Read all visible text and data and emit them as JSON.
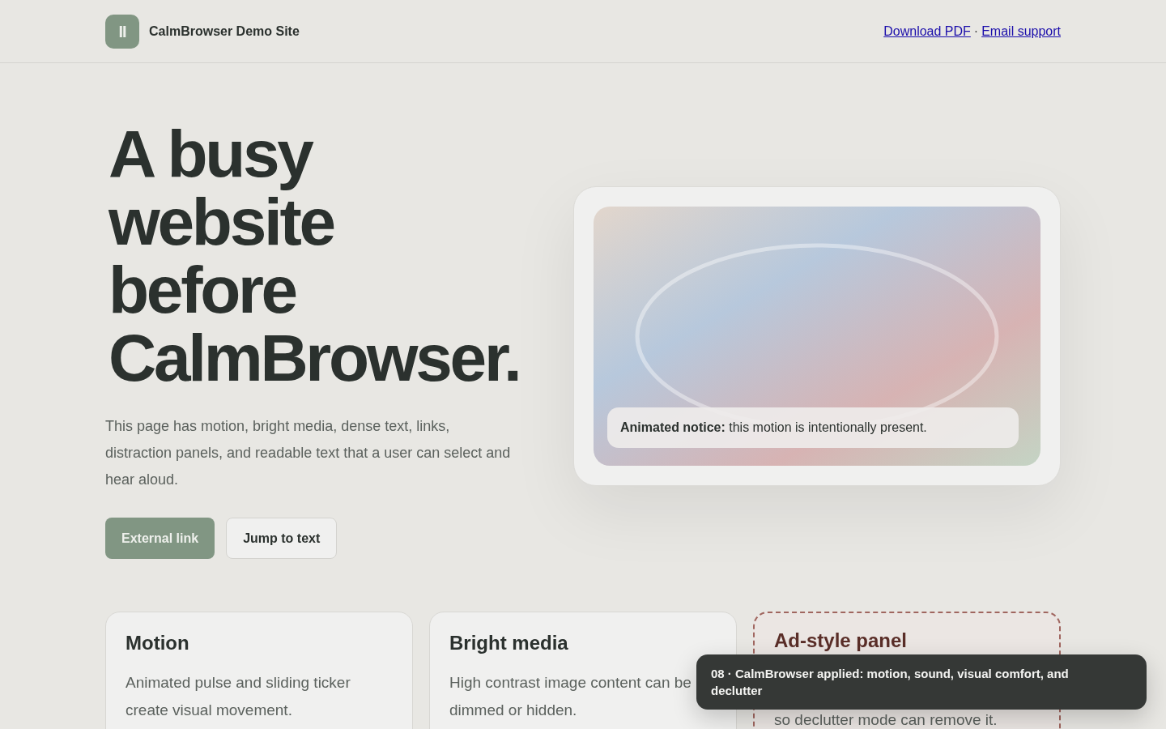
{
  "header": {
    "logo_glyph": "II",
    "site_name": "CalmBrowser Demo Site",
    "links": [
      {
        "label": "Download PDF"
      },
      {
        "label": "Email support"
      }
    ],
    "separator": "·"
  },
  "hero": {
    "headline": [
      "A busy",
      "website",
      "before",
      "CalmBrowser."
    ],
    "intro": "This page has motion, bright media, dense text, links, distraction panels, and readable text that a user can select and hear aloud.",
    "buttons": [
      {
        "label": "External link",
        "kind": "primary"
      },
      {
        "label": "Jump to text",
        "kind": "secondary"
      }
    ],
    "media": {
      "notice": "**Animated notice:** this motion is intentionally present."
    }
  },
  "cards": [
    {
      "title": "Motion",
      "text": "Animated pulse and sliding ticker create visual movement.",
      "kind": "plain"
    },
    {
      "title": "Bright media",
      "text": "High contrast image content can be dimmed or hidden.",
      "kind": "plain"
    },
    {
      "title": "Ad-style panel",
      "text": "so declutter mode can remove it.",
      "kind": "ad"
    }
  ],
  "toast": {
    "text": "08 · CalmBrowser applied: motion, sound, visual comfort, and declutter"
  }
}
